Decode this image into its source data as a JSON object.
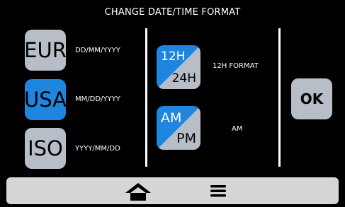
{
  "header": {
    "title": "CHANGE DATE/TIME FORMAT"
  },
  "date_formats": [
    {
      "button": "EUR",
      "label": "DD/MM/YYYY",
      "selected": false
    },
    {
      "button": "USA",
      "label": "MM/DD/YYYY",
      "selected": true
    },
    {
      "button": "ISO",
      "label": "YYYY/MM/DD",
      "selected": false
    }
  ],
  "time_format": {
    "top": "12H",
    "bottom": "24H",
    "value": "12H FORMAT"
  },
  "ampm": {
    "top": "AM",
    "bottom": "PM",
    "value": "AM"
  },
  "ok_label": "OK",
  "bottom_bar": {
    "home_icon": "home-icon",
    "menu_icon": "hamburger-menu-icon"
  },
  "colors": {
    "selected": "#1f86e0",
    "unselected": "#b7bec8",
    "background": "#000000",
    "bar": "#d6d6d6"
  }
}
